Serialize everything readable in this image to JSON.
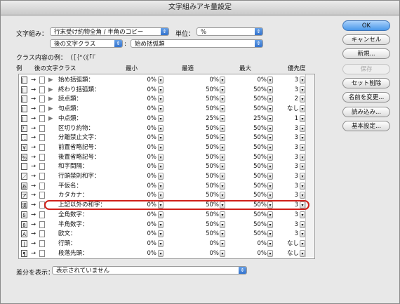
{
  "title": "文字組みアキ量設定",
  "mojigumi": {
    "label": "文字組み：",
    "value": "行末受け約物全角 / 半角のコピー"
  },
  "unit": {
    "label": "単位：",
    "value": "%"
  },
  "class_after": {
    "value": "後の文字クラス",
    "sep": ":",
    "class_value": "始め括弧類"
  },
  "class_example": {
    "label": "クラス内容の例：",
    "value": "（［｛“〈《「『"
  },
  "columns": {
    "example": "例",
    "after_class": "後の文字クラス",
    "min": "最小",
    "opt": "最適",
    "max": "最大",
    "priority": "優先度"
  },
  "arrow": "→",
  "spin_glyph": "▾",
  "rows": [
    {
      "g": "〕",
      "expand": "▶",
      "name": "始め括弧類：",
      "min": "0%",
      "opt": "0%",
      "max": "0%",
      "pri": "3"
    },
    {
      "g": "〕",
      "expand": "▶",
      "name": "終わり括弧類：",
      "min": "0%",
      "opt": "50%",
      "max": "50%",
      "pri": "3"
    },
    {
      "g": "〕",
      "expand": "▶",
      "name": "読点類：",
      "min": "0%",
      "opt": "50%",
      "max": "50%",
      "pri": "2"
    },
    {
      "g": "〕",
      "expand": "▶",
      "name": "句点類：",
      "min": "0%",
      "opt": "50%",
      "max": "50%",
      "pri": "なし"
    },
    {
      "g": "〕",
      "expand": "▶",
      "name": "中点類：",
      "min": "0%",
      "opt": "25%",
      "max": "25%",
      "pri": "1"
    },
    {
      "g": "？",
      "expand": "",
      "name": "区切り約物：",
      "min": "0%",
      "opt": "50%",
      "max": "50%",
      "pri": "3"
    },
    {
      "g": "…",
      "expand": "",
      "name": "分離禁止文字：",
      "min": "0%",
      "opt": "50%",
      "max": "50%",
      "pri": "3"
    },
    {
      "g": "￥",
      "expand": "",
      "name": "前置省略記号：",
      "min": "0%",
      "opt": "50%",
      "max": "50%",
      "pri": "3"
    },
    {
      "g": "％",
      "expand": "",
      "name": "後置省略記号：",
      "min": "0%",
      "opt": "50%",
      "max": "50%",
      "pri": "3"
    },
    {
      "g": "",
      "expand": "",
      "name": "和字間隔：",
      "min": "0%",
      "opt": "50%",
      "max": "50%",
      "pri": "3"
    },
    {
      "g": "／",
      "expand": "",
      "name": "行頭禁則和字：",
      "min": "0%",
      "opt": "50%",
      "max": "50%",
      "pri": "3"
    },
    {
      "g": "あ",
      "expand": "",
      "name": "平仮名：",
      "min": "0%",
      "opt": "50%",
      "max": "50%",
      "pri": "3"
    },
    {
      "g": "ア",
      "expand": "",
      "name": "カタカナ：",
      "min": "0%",
      "opt": "50%",
      "max": "50%",
      "pri": "3"
    },
    {
      "g": "漢",
      "expand": "",
      "name": "上記以外の和字：",
      "min": "0%",
      "opt": "50%",
      "max": "50%",
      "pri": "3"
    },
    {
      "g": "８",
      "expand": "",
      "name": "全角数字：",
      "min": "0%",
      "opt": "50%",
      "max": "50%",
      "pri": "3"
    },
    {
      "g": "8",
      "expand": "",
      "name": "半角数字：",
      "min": "0%",
      "opt": "50%",
      "max": "50%",
      "pri": "3"
    },
    {
      "g": "A",
      "expand": "",
      "name": "欧文：",
      "min": "0%",
      "opt": "50%",
      "max": "50%",
      "pri": "3"
    },
    {
      "g": "|",
      "expand": "",
      "name": "行頭：",
      "min": "0%",
      "opt": "0%",
      "max": "0%",
      "pri": "なし"
    },
    {
      "g": "¶",
      "expand": "",
      "name": "段落先頭：",
      "min": "0%",
      "opt": "0%",
      "max": "0%",
      "pri": "なし"
    }
  ],
  "buttons": {
    "ok": "OK",
    "cancel": "キャンセル",
    "new": "新規...",
    "save": "保存",
    "delete_set": "セット削除",
    "rename": "名前を変更...",
    "load": "読み込み...",
    "basic": "基本設定..."
  },
  "diff": {
    "label": "差分を表示：",
    "value": "表示されていません"
  },
  "colors": {
    "accent": "#3f86e0",
    "highlight": "#d0201a"
  }
}
